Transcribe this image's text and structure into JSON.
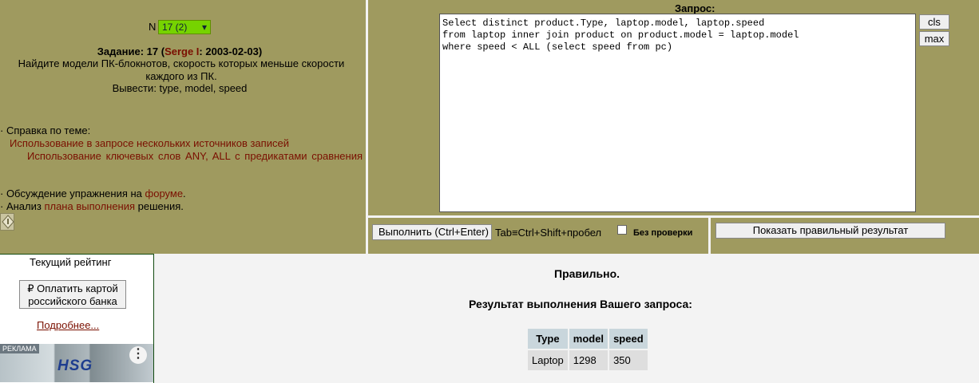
{
  "task": {
    "n_label": "N",
    "selector_value": "17 (2)",
    "title_prefix": "Задание: 17 (",
    "author": "Serge I",
    "title_suffix": ": 2003-02-03)",
    "text": "Найдите модели ПК-блокнотов, скорость которых меньше скорости каждого из ПК.",
    "output": "Вывести: type, model, speed"
  },
  "help": {
    "bullet1": "· Справка по теме:",
    "link1": "Использование в запросе нескольких источников записей",
    "link2": "Использование ключевых слов ANY, ALL с предикатами сравнения",
    "forum_prefix": "· Обсуждение упражнения на ",
    "forum_link": "форуме",
    "forum_suffix": ".",
    "plan_prefix": "· Анализ ",
    "plan_link": "плана выполнения",
    "plan_suffix": " решения."
  },
  "query": {
    "label": "Запрос:",
    "text": "Select distinct product.Type, laptop.model, laptop.speed\nfrom laptop inner join product on product.model = laptop.model\nwhere speed < ALL (select speed from pc)",
    "cls_label": "cls",
    "max_label": "max"
  },
  "controls": {
    "execute_label": "Выполнить (Ctrl+Enter)",
    "tab_hint": "Tab≡Ctrl+Shift+пробел",
    "nocheck_label": "Без проверки",
    "show_correct_label": "Показать правильный результат"
  },
  "sidebar": {
    "rating_title": "Текущий рейтинг",
    "pay_button": "₽ Оплатить картой российского банка",
    "more_link": "Подробнее...",
    "ad_tag": "РЕКЛАМА",
    "ad_logo": "HSG",
    "ad_menu": "⋮"
  },
  "result": {
    "status": "Правильно.",
    "title": "Результат выполнения Вашего запроса:",
    "headers": [
      "Type",
      "model",
      "speed"
    ],
    "rows": [
      [
        "Laptop",
        "1298",
        "350"
      ]
    ]
  },
  "colors": {
    "panel": "#9f9a5f",
    "link": "#7a0f00",
    "selector": "#76d300"
  }
}
